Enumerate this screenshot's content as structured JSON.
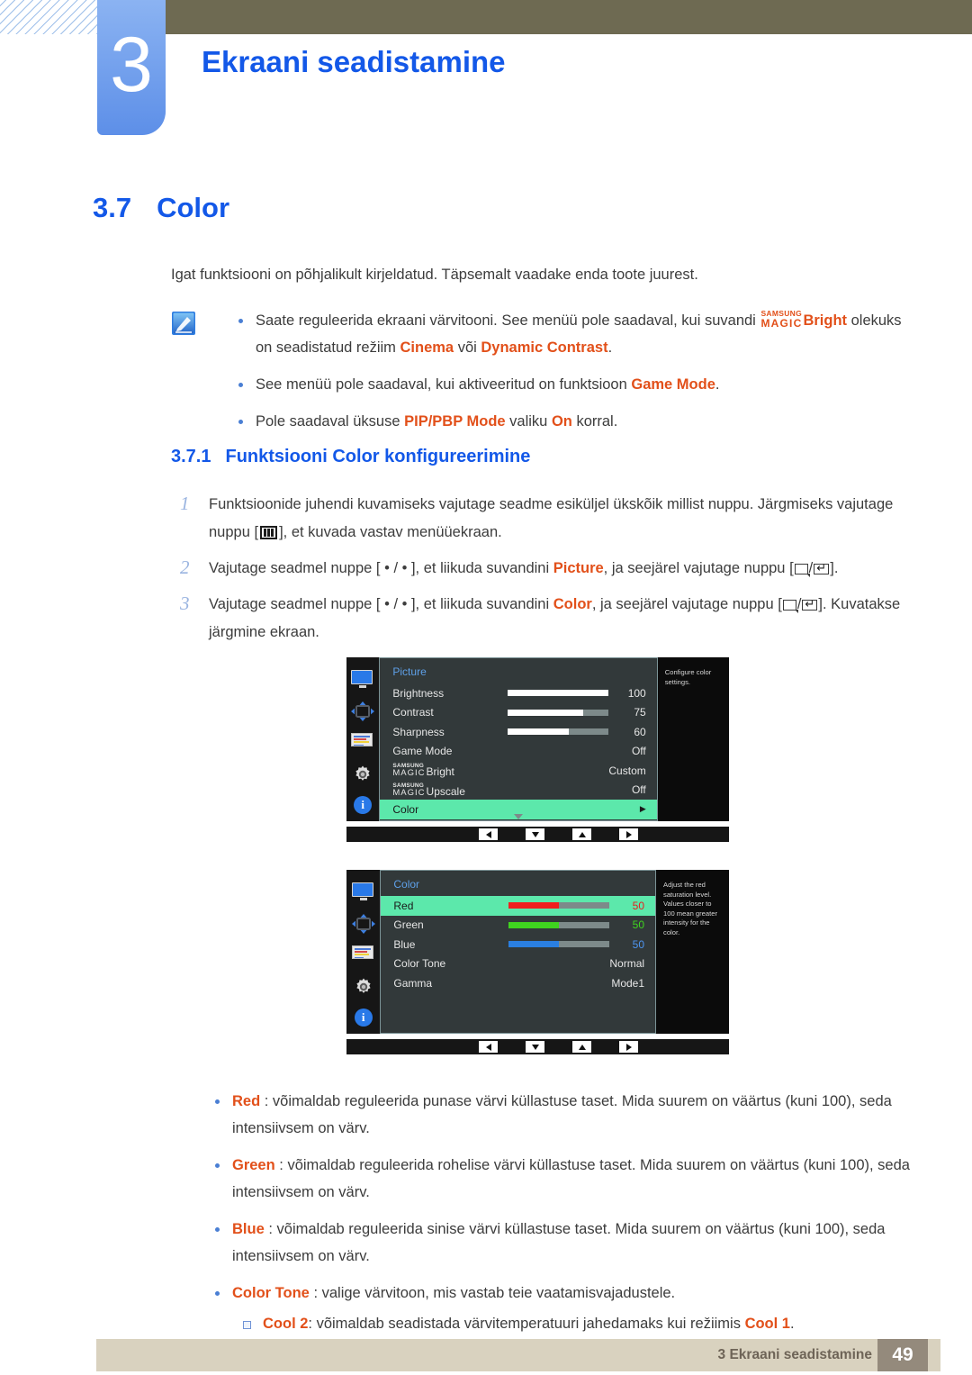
{
  "header": {
    "chapter_number": "3",
    "chapter_title": "Ekraani seadistamine",
    "olive_color": "#6e6a52",
    "tab_color": "#5d8fe8",
    "title_color": "#1358e8"
  },
  "section": {
    "number": "3.7",
    "title": "Color"
  },
  "intro": "Igat funktsiooni on põhjalikult kirjeldatud. Täpsemalt vaadake enda toote juurest.",
  "note_icon": "note-pencil-icon",
  "notes": [
    {
      "prefix": "Saate reguleerida ekraani värvitooni. See menüü pole saadaval, kui suvandi ",
      "magic_top": "SAMSUNG",
      "magic_bottom": "MAGIC",
      "magic_suffix": "Bright",
      "mid": " olekuks on seadistatud režiim ",
      "kw1": "Cinema",
      "mid2": " või ",
      "kw2": "Dynamic Contrast",
      "tail": "."
    },
    {
      "prefix": "See menüü pole saadaval, kui aktiveeritud on funktsioon ",
      "kw1": "Game Mode",
      "tail": "."
    },
    {
      "prefix": "Pole saadaval üksuse ",
      "kw1": "PIP/PBP Mode",
      "mid": " valiku ",
      "kw2": "On",
      "tail": " korral."
    }
  ],
  "subsection": {
    "number": "3.7.1",
    "title": "Funktsiooni Color konfigureerimine"
  },
  "steps": [
    {
      "n": "1",
      "part1": "Funktsioonide juhendi kuvamiseks vajutage seadme esiküljel ükskõik millist nuppu. Järgmiseks vajutage nuppu [",
      "icon": "menu-icon",
      "part2": "], et kuvada vastav menüüekraan."
    },
    {
      "n": "2",
      "part1": "Vajutage seadmel nuppe [ • / • ], et liikuda suvandini ",
      "kw": "Picture",
      "part2": ", ja seejärel vajutage nuppu [",
      "icon1": "source-icon",
      "slash": "/",
      "icon2": "return-icon",
      "part3": "]."
    },
    {
      "n": "3",
      "part1": "Vajutage seadmel nuppe [ • / • ], et liikuda suvandini ",
      "kw": "Color",
      "part2": ", ja seejärel vajutage nuppu [",
      "icon1": "source-icon",
      "slash": "/",
      "icon2": "return-icon",
      "part3": "]. Kuvatakse järgmine ekraan."
    }
  ],
  "osd_picture": {
    "title": "Picture",
    "sidebar_icons": [
      "monitor-icon",
      "arrows-icon",
      "osd-icon",
      "gear-icon",
      "info-icon"
    ],
    "rows": [
      {
        "label": "Brightness",
        "type": "slider",
        "fill": 100,
        "value": "100"
      },
      {
        "label": "Contrast",
        "type": "slider",
        "fill": 75,
        "value": "75"
      },
      {
        "label": "Sharpness",
        "type": "slider",
        "fill": 60,
        "value": "60"
      },
      {
        "label": "Game Mode",
        "type": "value",
        "value": "Off"
      },
      {
        "label": "MAGICBright",
        "type": "magic",
        "magic_top": "SAMSUNG",
        "magic_bottom": "MAGIC",
        "suffix": "Bright",
        "value": "Custom"
      },
      {
        "label": "MAGICUpscale",
        "type": "magic",
        "magic_top": "SAMSUNG",
        "magic_bottom": "MAGIC",
        "suffix": "Upscale",
        "value": "Off"
      },
      {
        "label": "Color",
        "type": "arrow",
        "value": "▶",
        "selected": true
      }
    ],
    "help": "Configure color settings.",
    "nav": [
      "nav-left",
      "nav-down",
      "nav-up",
      "nav-right"
    ],
    "highlight_color": "#5ce8ab"
  },
  "osd_color": {
    "title": "Color",
    "sidebar_icons": [
      "monitor-icon",
      "arrows-icon",
      "osd-icon",
      "gear-icon",
      "info-icon"
    ],
    "rows": [
      {
        "label": "Red",
        "type": "slider",
        "fill": 50,
        "value": "50",
        "color": "#ef1f1f",
        "selected": true
      },
      {
        "label": "Green",
        "type": "slider",
        "fill": 50,
        "value": "50",
        "color": "#3fd41f"
      },
      {
        "label": "Blue",
        "type": "slider",
        "fill": 50,
        "value": "50",
        "color": "#2a7fe0"
      },
      {
        "label": "Color Tone",
        "type": "value",
        "value": "Normal"
      },
      {
        "label": "Gamma",
        "type": "value",
        "value": "Mode1"
      }
    ],
    "help": "Adjust the red saturation level. Values closer to 100 mean greater intensity for the color.",
    "nav": [
      "nav-left",
      "nav-down",
      "nav-up",
      "nav-right"
    ],
    "highlight_color": "#5ce8ab"
  },
  "descriptions": [
    {
      "kw": "Red",
      "text": " : võimaldab reguleerida punase värvi küllastuse taset. Mida suurem on väärtus (kuni 100), seda intensiivsem on värv."
    },
    {
      "kw": "Green",
      "text": " : võimaldab reguleerida rohelise värvi küllastuse taset. Mida suurem on väärtus (kuni 100), seda intensiivsem on värv."
    },
    {
      "kw": "Blue",
      "text": " : võimaldab reguleerida sinise värvi küllastuse taset. Mida suurem on väärtus (kuni 100), seda intensiivsem on värv."
    },
    {
      "kw": "Color Tone",
      "text": " : valige värvitoon, mis vastab teie vaatamisvajadustele."
    }
  ],
  "sub_description": {
    "kw": "Cool 2",
    "mid": ": võimaldab seadistada värvitemperatuuri jahedamaks kui režiimis ",
    "kw2": "Cool 1",
    "tail": "."
  },
  "footer": {
    "text": "3 Ekraani seadistamine",
    "page": "49",
    "bar_color": "#d9d2bf",
    "page_color": "#948a7c"
  }
}
